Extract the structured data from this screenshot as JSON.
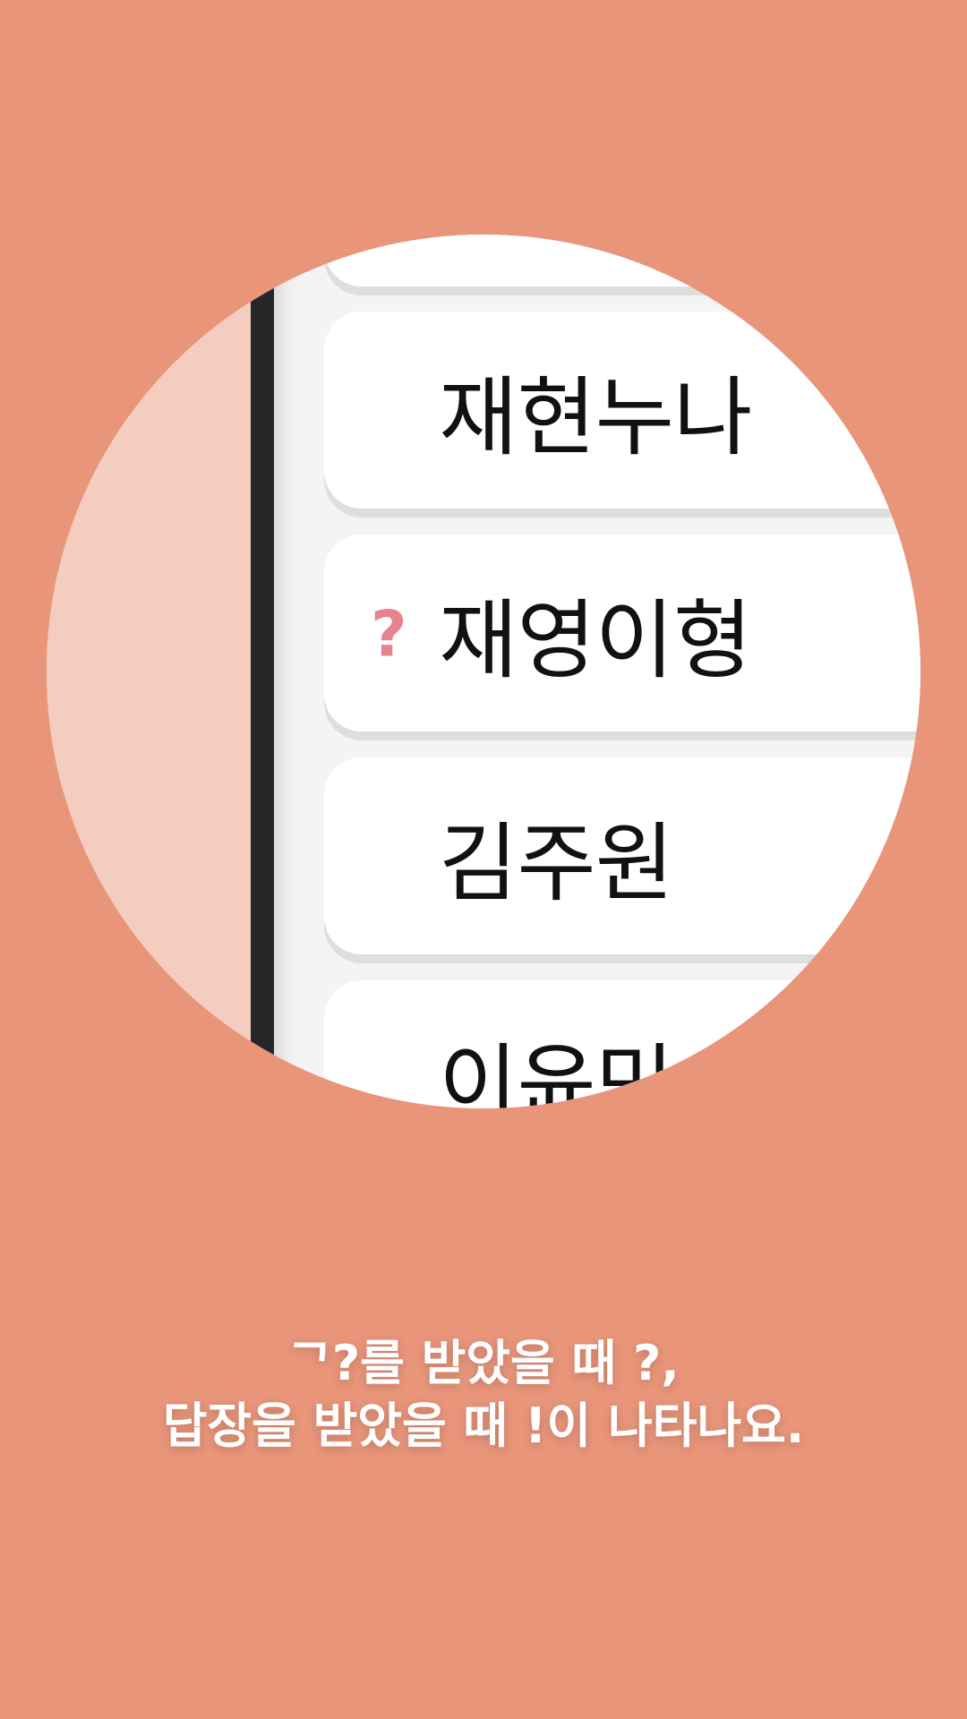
{
  "list": {
    "items": [
      {
        "name": "",
        "mark": ""
      },
      {
        "name": "재현누나",
        "mark": ""
      },
      {
        "name": "재영이형",
        "mark": "?"
      },
      {
        "name": "김주원",
        "mark": ""
      },
      {
        "name": "이윤민",
        "mark": ""
      }
    ]
  },
  "caption": {
    "line1": "ᄀ?를 받았을 때 ?,",
    "line2": "답장을 받았을 때 !이 나타나요."
  },
  "colors": {
    "background": "#E8957A",
    "left_panel": "#F5CCC0",
    "divider": "#262626",
    "question_mark": "#E8828F"
  }
}
